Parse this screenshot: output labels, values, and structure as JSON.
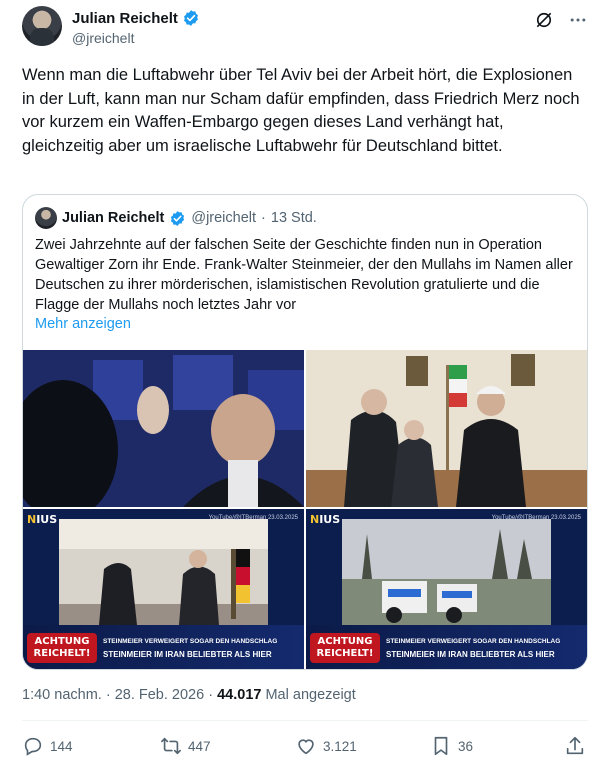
{
  "author": {
    "name": "Julian Reichelt",
    "handle": "@jreichelt"
  },
  "tweet_text": "Wenn man die Luftabwehr über Tel Aviv bei der Arbeit hört, die Explosionen in der Luft, kann man nur Scham dafür empfinden, dass Friedrich Merz noch vor kurzem ein Waffen-Embargo gegen dieses Land verhängt hat, gleichzeitig aber um israelische Luftabwehr für Deutschland bittet.",
  "quote": {
    "name": "Julian Reichelt",
    "handle": "@jreichelt",
    "age": "13 Std.",
    "text": "Zwei Jahrzehnte auf der falschen Seite der Geschichte finden nun in Operation Gewaltiger Zorn ihr Ende. Frank-Walter Steinmeier, der den Mullahs im Namen aller Deutschen zu ihrer mörderischen, islamistischen Revolution gratulierte und die Flagge der Mullahs noch letztes Jahr vor",
    "show_more": "Mehr anzeigen",
    "news_overlay": {
      "logo_n": "N",
      "logo_rest": "IUS",
      "source_small": "YouTube/@ITBerman 23.03.2025",
      "badge": "ACHTUNG REICHELT!",
      "sub_headline": "STEINMEIER VERWEIGERT SOGAR DEN HANDSCHLAG",
      "headline": "STEINMEIER IM IRAN BELIEBTER ALS HIER"
    }
  },
  "meta": {
    "time": "1:40 nachm.",
    "sep": " · ",
    "date": "28. Feb. 2026",
    "sep2": " · ",
    "views": "44.017",
    "views_label": " Mal angezeigt"
  },
  "actions": {
    "replies": "144",
    "reposts": "447",
    "likes": "3.121",
    "bookmarks": "36"
  },
  "colors": {
    "accent": "#1d9bf0",
    "muted": "#536471",
    "text": "#0f1419"
  }
}
